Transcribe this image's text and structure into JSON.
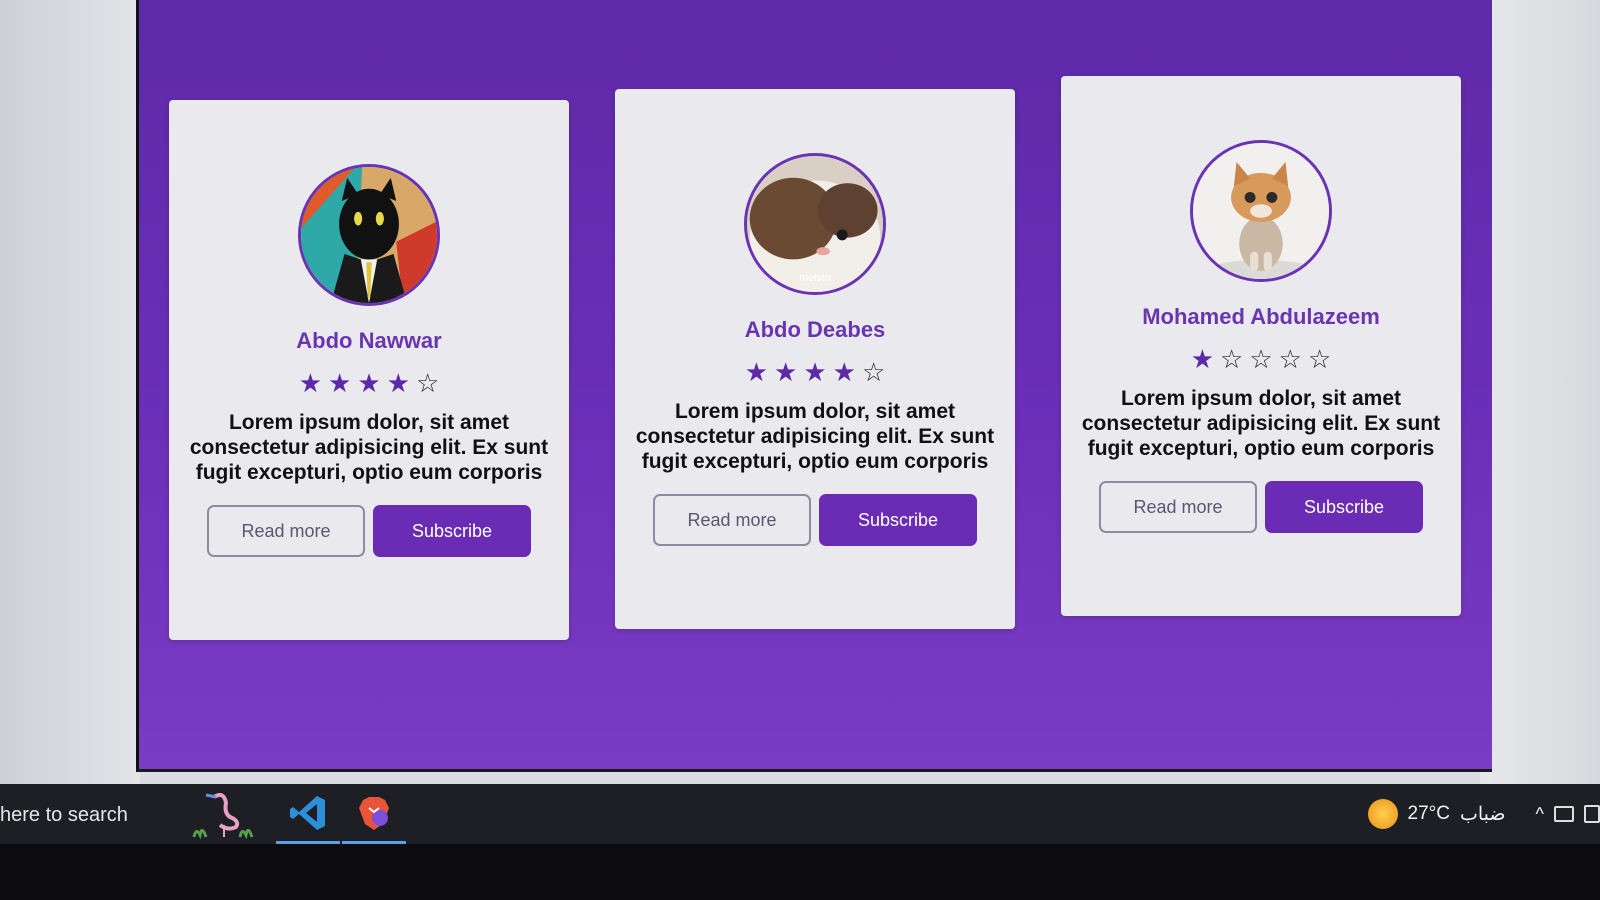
{
  "cards": [
    {
      "name": "Abdo Nawwar",
      "rating": 4,
      "stars": [
        "★",
        "★",
        "★",
        "★",
        "☆"
      ],
      "description": "Lorem ipsum dolor, sit amet consectetur adipisicing elit. Ex sunt fugit excepturi, optio eum corporis",
      "read_more_label": "Read more",
      "subscribe_label": "Subscribe",
      "avatar": "black-cat-in-suit"
    },
    {
      "name": "Abdo Deabes",
      "rating": 4,
      "stars": [
        "★",
        "★",
        "★",
        "★",
        "☆"
      ],
      "description": "Lorem ipsum dolor, sit amet consectetur adipisicing elit. Ex sunt fugit excepturi, optio eum corporis",
      "read_more_label": "Read more",
      "subscribe_label": "Subscribe",
      "avatar": "brown-white-cat",
      "avatar_caption": "melvin"
    },
    {
      "name": "Mohamed Abdulazeem",
      "rating": 1,
      "stars": [
        "★",
        "☆",
        "☆",
        "☆",
        "☆"
      ],
      "description": "Lorem ipsum dolor, sit amet consectetur adipisicing elit. Ex sunt fugit excepturi, optio eum corporis",
      "read_more_label": "Read more",
      "subscribe_label": "Subscribe",
      "avatar": "orange-kitten"
    }
  ],
  "taskbar": {
    "search_text": "here to search",
    "apps": [
      "flamingo-icon",
      "vscode-icon",
      "brave-icon"
    ],
    "weather_temp": "27°C",
    "weather_condition": "ضباب"
  },
  "colors": {
    "background": "#6b2fb8",
    "card": "#e9e9ee",
    "accent": "#6a2bb5",
    "name": "#6a36b0"
  }
}
